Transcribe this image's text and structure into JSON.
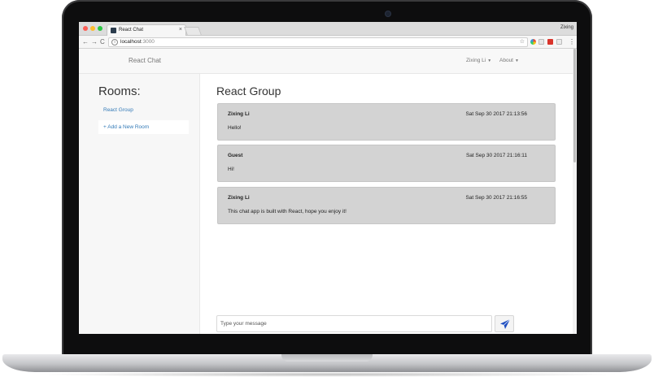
{
  "browser": {
    "tab_title": "React Chat",
    "tab_close": "×",
    "profile_name": "Zixing",
    "url_host": "localhost",
    "url_port": ":3000",
    "back_icon": "←",
    "forward_icon": "→",
    "reload_icon": "C",
    "star_icon": "☆",
    "menu_icon": "⋮"
  },
  "navbar": {
    "brand": "React Chat",
    "user_menu": "Zixing Li",
    "about_menu": "About",
    "caret": "▼"
  },
  "sidebar": {
    "title": "Rooms:",
    "rooms": [
      {
        "label": "React Group"
      }
    ],
    "add_room": "+ Add a New Room"
  },
  "main": {
    "title": "React Group",
    "messages": [
      {
        "author": "Zixing Li",
        "time": "Sat Sep 30 2017 21:13:56",
        "text": "Hello!"
      },
      {
        "author": "Guest",
        "time": "Sat Sep 30 2017 21:16:11",
        "text": "Hi!"
      },
      {
        "author": "Zixing Li",
        "time": "Sat Sep 30 2017 21:16:55",
        "text": "This chat app is built with React, hope you enjoy it!"
      }
    ],
    "composer": {
      "placeholder": "Type your message",
      "value": ""
    }
  },
  "colors": {
    "link": "#337ab7",
    "message_bg": "#d3d3d3",
    "send_icon": "#1f4fc1"
  },
  "icons": {
    "send": "send-icon",
    "camera": "camera-icon"
  }
}
